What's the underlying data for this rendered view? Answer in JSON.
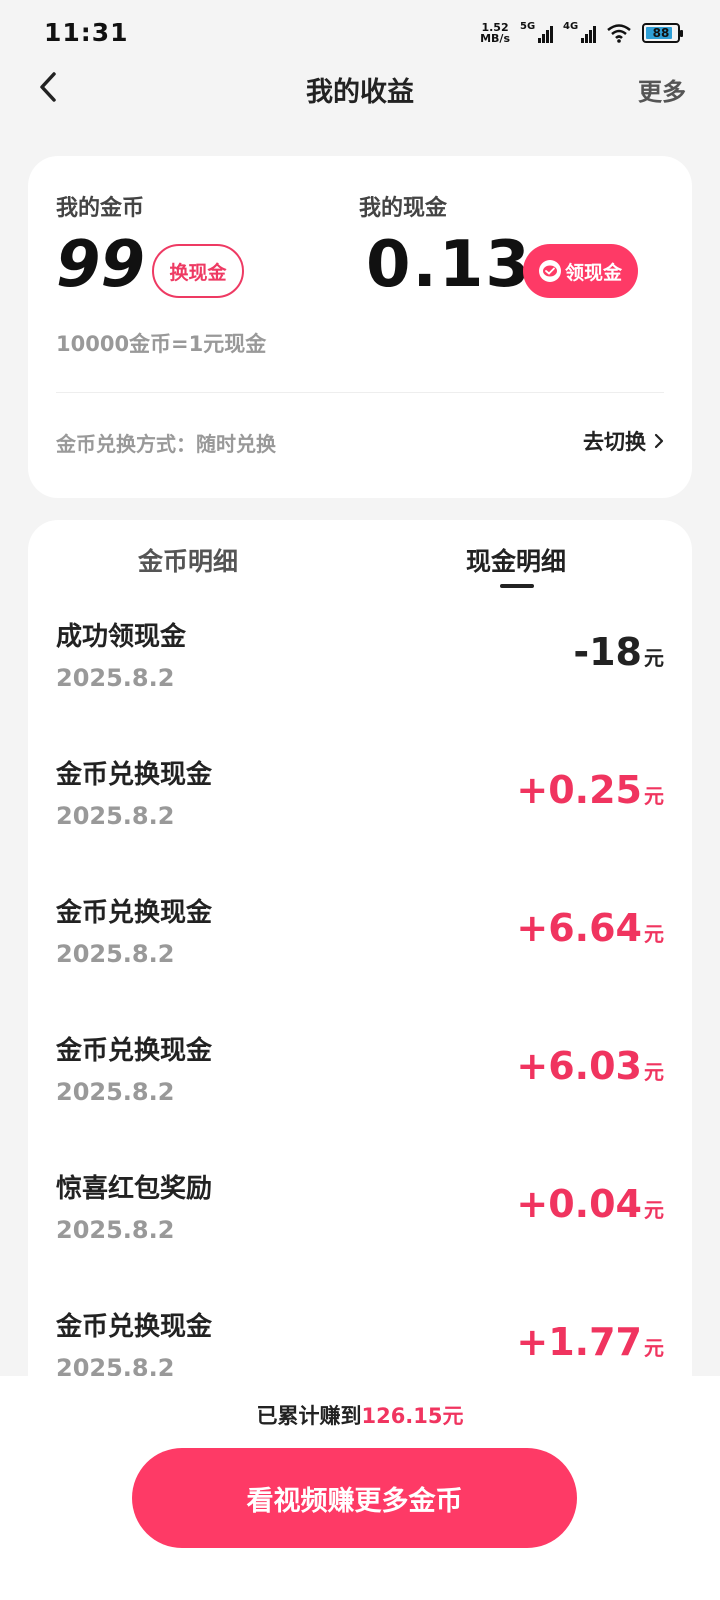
{
  "status_bar": {
    "time": "11:31",
    "net_speed_value": "1.52",
    "net_speed_unit": "MB/s",
    "signal1_label": "5G",
    "signal2_label": "4G",
    "battery": "88",
    "battery_level_percent": 88
  },
  "header": {
    "back_icon": "chevron-left-icon",
    "title": "我的收益",
    "more": "更多"
  },
  "summary": {
    "coins_label": "我的金币",
    "coins_value": "99",
    "exchange_button": "换现金",
    "cash_label": "我的现金",
    "cash_value": "0.13",
    "claim_button": "领现金",
    "claim_icon": "wechat-icon",
    "rate_text": "10000金币=1元现金",
    "method_text": "金币兑换方式：随时兑换",
    "switch_link": "去切换"
  },
  "tabs": [
    {
      "label": "金币明细",
      "active": false
    },
    {
      "label": "现金明细",
      "active": true
    }
  ],
  "transactions": [
    {
      "title": "成功领现金",
      "date": "2025.8.2",
      "amount": "-18",
      "unit": "元",
      "positive": false
    },
    {
      "title": "金币兑换现金",
      "date": "2025.8.2",
      "amount": "+0.25",
      "unit": "元",
      "positive": true
    },
    {
      "title": "金币兑换现金",
      "date": "2025.8.2",
      "amount": "+6.64",
      "unit": "元",
      "positive": true
    },
    {
      "title": "金币兑换现金",
      "date": "2025.8.2",
      "amount": "+6.03",
      "unit": "元",
      "positive": true
    },
    {
      "title": "惊喜红包奖励",
      "date": "2025.8.2",
      "amount": "+0.04",
      "unit": "元",
      "positive": true
    },
    {
      "title": "金币兑换现金",
      "date": "2025.8.2",
      "amount": "+1.77",
      "unit": "元",
      "positive": true
    }
  ],
  "footer": {
    "total_prefix": "已累计赚到",
    "total_amount": "126.15元",
    "cta": "看视频赚更多金币"
  },
  "colors": {
    "accent": "#fe3a66",
    "positive_amount": "#f0345f",
    "background": "#f4f4f4"
  }
}
